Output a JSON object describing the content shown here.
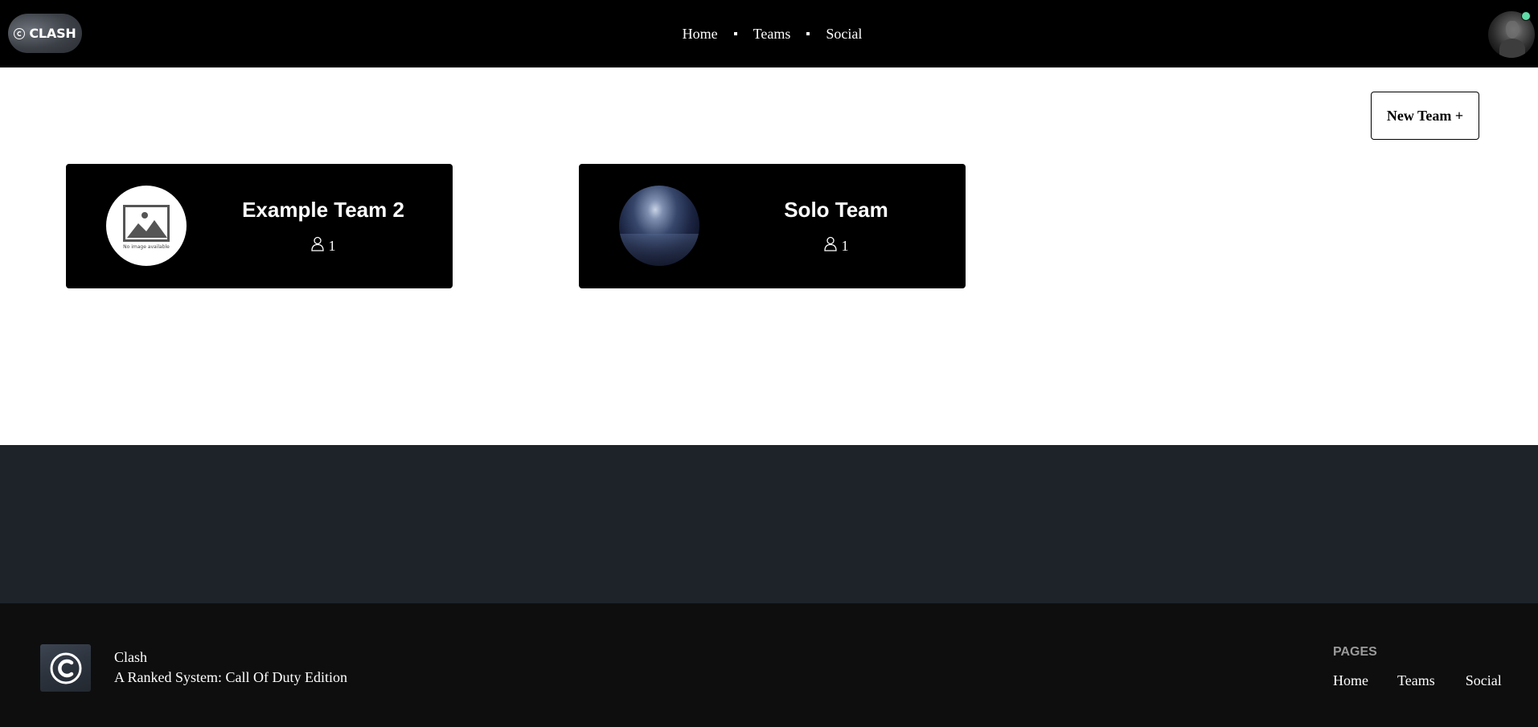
{
  "header": {
    "logo_text": "CLASH",
    "logo_icon": "copyright-c-icon",
    "nav": [
      {
        "label": "Home"
      },
      {
        "label": "Teams"
      },
      {
        "label": "Social"
      }
    ],
    "avatar_icon": "user-avatar",
    "online_status_color": "#5fdca8"
  },
  "main": {
    "new_team_button": "New Team +",
    "teams": [
      {
        "name": "Example Team 2",
        "members": "1",
        "image": "no-image-placeholder",
        "image_caption": "No image available"
      },
      {
        "name": "Solo Team",
        "members": "1",
        "image": "team-image-space"
      }
    ]
  },
  "footer": {
    "title": "Clash",
    "subtitle": "A Ranked System: Call Of Duty Edition",
    "pages_heading": "PAGES",
    "links": [
      {
        "label": "Home"
      },
      {
        "label": "Teams"
      },
      {
        "label": "Social"
      }
    ]
  },
  "colors": {
    "header_bg": "#000000",
    "card_bg": "#000000",
    "slate_bg": "#1e232a",
    "footer_bg": "#0e0e0e"
  }
}
